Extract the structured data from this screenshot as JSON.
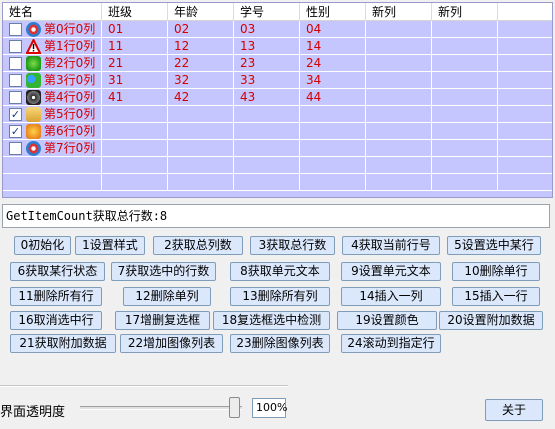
{
  "grid": {
    "headers": [
      "姓名",
      "班级",
      "年龄",
      "学号",
      "性别",
      "新列",
      "新列"
    ],
    "rows": [
      {
        "checked": false,
        "icon": "chrome-icon",
        "name": "第0行0列",
        "c1": "01",
        "c2": "02",
        "c3": "03",
        "c4": "04"
      },
      {
        "checked": false,
        "icon": "warning-icon",
        "name": "第1行0列",
        "c1": "11",
        "c2": "12",
        "c3": "13",
        "c4": "14"
      },
      {
        "checked": false,
        "icon": "play-icon",
        "name": "第2行0列",
        "c1": "21",
        "c2": "22",
        "c3": "23",
        "c4": "24"
      },
      {
        "checked": false,
        "icon": "users-icon",
        "name": "第3行0列",
        "c1": "31",
        "c2": "32",
        "c3": "33",
        "c4": "34"
      },
      {
        "checked": false,
        "icon": "disc-icon",
        "name": "第4行0列",
        "c1": "41",
        "c2": "42",
        "c3": "43",
        "c4": "44"
      },
      {
        "checked": true,
        "icon": "folder-icon",
        "name": "第5行0列",
        "c1": "",
        "c2": "",
        "c3": "",
        "c4": ""
      },
      {
        "checked": true,
        "icon": "face-icon",
        "name": "第6行0列",
        "c1": "",
        "c2": "",
        "c3": "",
        "c4": ""
      },
      {
        "checked": false,
        "icon": "chrome-icon",
        "name": "第7行0列",
        "c1": "",
        "c2": "",
        "c3": "",
        "c4": ""
      }
    ]
  },
  "status_text": "GetItemCount获取总行数:8",
  "buttons": [
    "0初始化",
    "1设置样式",
    "2获取总列数",
    "3获取总行数",
    "4获取当前行号",
    "5设置选中某行",
    "6获取某行状态",
    "7获取选中的行数",
    "8获取单元文本",
    "9设置单元文本",
    "10删除单行",
    "11删除所有行",
    "12删除单列",
    "13删除所有列",
    "14插入一列",
    "15插入一行",
    "16取消选中行",
    "17增删复选框",
    "18复选框选中检测",
    "19设置颜色",
    "20设置附加数据",
    "21获取附加数据",
    "22增加图像列表",
    "23删除图像列表",
    "24滚动到指定行"
  ],
  "opacity": {
    "label": "界面透明度",
    "value": "100%"
  },
  "about_label": "关于",
  "colors": {
    "grid_bg": "#c6c6ff",
    "cell_text": "#d40000",
    "button_bg": "#dbe7fb"
  }
}
